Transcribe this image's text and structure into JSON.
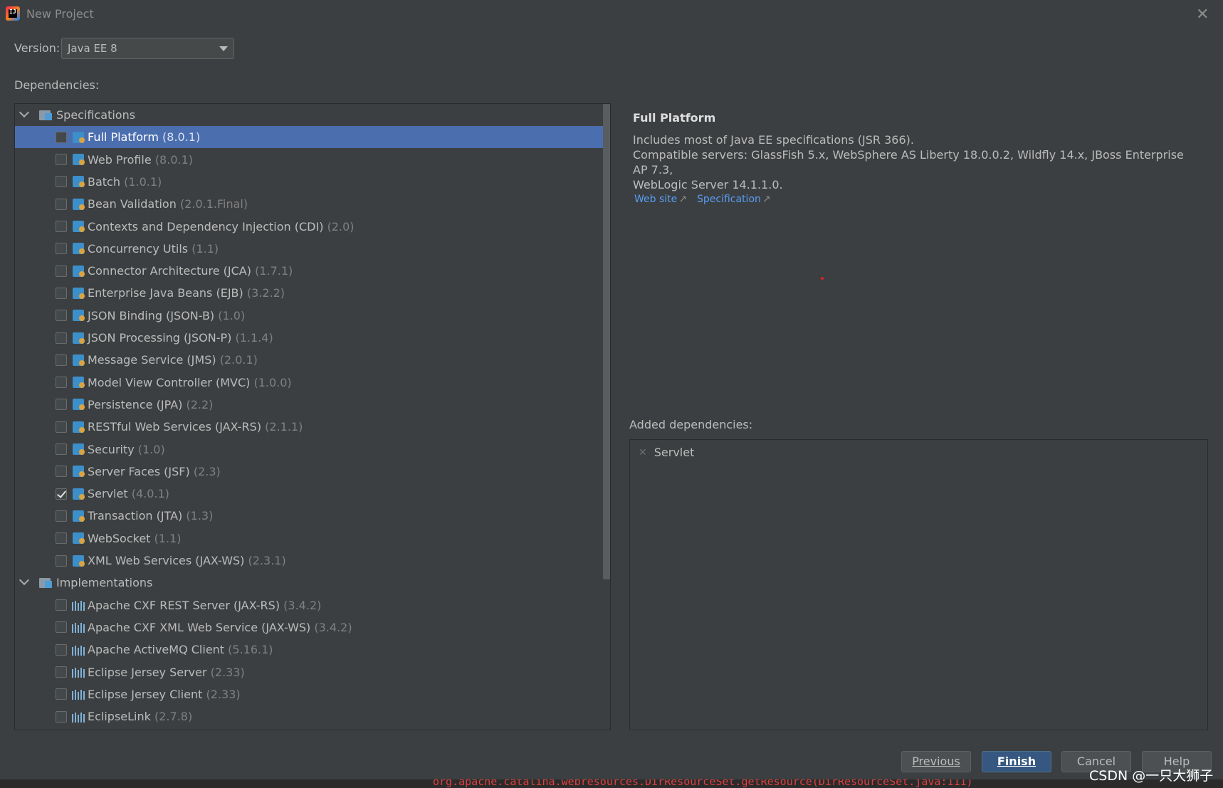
{
  "window": {
    "title": "New Project"
  },
  "version": {
    "label": "Version:",
    "value": "Java EE 8"
  },
  "dependencies_label": "Dependencies:",
  "tree": {
    "specifications": {
      "label": "Specifications",
      "items": [
        {
          "name": "Full Platform",
          "version": "(8.0.1)",
          "checked": false,
          "selected": true
        },
        {
          "name": "Web Profile",
          "version": "(8.0.1)",
          "checked": false
        },
        {
          "name": "Batch",
          "version": "(1.0.1)",
          "checked": false
        },
        {
          "name": "Bean Validation",
          "version": "(2.0.1.Final)",
          "checked": false
        },
        {
          "name": "Contexts and Dependency Injection (CDI)",
          "version": "(2.0)",
          "checked": false
        },
        {
          "name": "Concurrency Utils",
          "version": "(1.1)",
          "checked": false
        },
        {
          "name": "Connector Architecture (JCA)",
          "version": "(1.7.1)",
          "checked": false
        },
        {
          "name": "Enterprise Java Beans (EJB)",
          "version": "(3.2.2)",
          "checked": false
        },
        {
          "name": "JSON Binding (JSON-B)",
          "version": "(1.0)",
          "checked": false
        },
        {
          "name": "JSON Processing (JSON-P)",
          "version": "(1.1.4)",
          "checked": false
        },
        {
          "name": "Message Service (JMS)",
          "version": "(2.0.1)",
          "checked": false
        },
        {
          "name": "Model View Controller (MVC)",
          "version": "(1.0.0)",
          "checked": false
        },
        {
          "name": "Persistence (JPA)",
          "version": "(2.2)",
          "checked": false
        },
        {
          "name": "RESTful Web Services (JAX-RS)",
          "version": "(2.1.1)",
          "checked": false
        },
        {
          "name": "Security",
          "version": "(1.0)",
          "checked": false
        },
        {
          "name": "Server Faces (JSF)",
          "version": "(2.3)",
          "checked": false
        },
        {
          "name": "Servlet",
          "version": "(4.0.1)",
          "checked": true
        },
        {
          "name": "Transaction (JTA)",
          "version": "(1.3)",
          "checked": false
        },
        {
          "name": "WebSocket",
          "version": "(1.1)",
          "checked": false
        },
        {
          "name": "XML Web Services (JAX-WS)",
          "version": "(2.3.1)",
          "checked": false
        }
      ]
    },
    "implementations": {
      "label": "Implementations",
      "items": [
        {
          "name": "Apache CXF REST Server (JAX-RS)",
          "version": "(3.4.2)",
          "checked": false
        },
        {
          "name": "Apache CXF XML Web Service (JAX-WS)",
          "version": "(3.4.2)",
          "checked": false
        },
        {
          "name": "Apache ActiveMQ Client",
          "version": "(5.16.1)",
          "checked": false
        },
        {
          "name": "Eclipse Jersey Server",
          "version": "(2.33)",
          "checked": false
        },
        {
          "name": "Eclipse Jersey Client",
          "version": "(2.33)",
          "checked": false
        },
        {
          "name": "EclipseLink",
          "version": "(2.7.8)",
          "checked": false
        }
      ]
    }
  },
  "detail": {
    "title": "Full Platform",
    "line1": "Includes most of Java EE specifications (JSR 366).",
    "line2": "Compatible servers: GlassFish 5.x, WebSphere AS Liberty 18.0.0.2, Wildfly 14.x, JBoss Enterprise AP 7.3,",
    "line3": "WebLogic Server 14.1.1.0.",
    "links": [
      "Web site",
      "Specification"
    ]
  },
  "added": {
    "label": "Added dependencies:",
    "items": [
      "Servlet"
    ]
  },
  "buttons": {
    "previous": "Previous",
    "finish": "Finish",
    "cancel": "Cancel",
    "help": "Help"
  },
  "background_code": "org.apache.catalina.webresources.DirResourceSet.getResource(DirResourceSet.java:111)",
  "watermark": "CSDN @一只大狮子",
  "colors": {
    "background": "#3c3f41",
    "selection": "#4b6eaf",
    "link": "#589df6",
    "primary_button": "#365880"
  }
}
